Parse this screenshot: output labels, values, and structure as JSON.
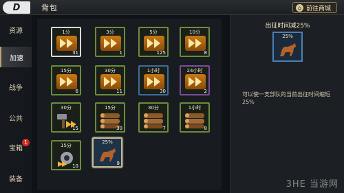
{
  "header": {
    "title": "背包",
    "shop_label": "前往商城"
  },
  "sidebar": {
    "items": [
      {
        "label": "资源"
      },
      {
        "label": "加速"
      },
      {
        "label": "战争"
      },
      {
        "label": "公共"
      },
      {
        "label": "宝箱",
        "badge": "1"
      },
      {
        "label": "装备"
      }
    ]
  },
  "grid": {
    "items": [
      {
        "label": "1分",
        "count": "31",
        "kind": "speedup"
      },
      {
        "label": "3分",
        "count": "1",
        "kind": "speedup"
      },
      {
        "label": "5分",
        "count": "125",
        "kind": "speedup"
      },
      {
        "label": "10分",
        "count": "8",
        "kind": "speedup"
      },
      {
        "label": "15分",
        "count": "6",
        "kind": "speedup"
      },
      {
        "label": "30分",
        "count": "11",
        "kind": "speedup"
      },
      {
        "label": "1小时",
        "count": "30",
        "kind": "speedup"
      },
      {
        "label": "24小时",
        "count": "2",
        "kind": "speedup"
      },
      {
        "label": "30分",
        "count": "15",
        "kind": "tool-speedup"
      },
      {
        "label": "15分",
        "count": "30",
        "kind": "logs"
      },
      {
        "label": "30分",
        "count": "7",
        "kind": "logs"
      },
      {
        "label": "1小时",
        "count": "8",
        "kind": "logs"
      },
      {
        "label": "15分",
        "count": "10",
        "kind": "gear-speedup"
      },
      {
        "label": "25%",
        "count": "9",
        "kind": "horse"
      }
    ]
  },
  "detail": {
    "title": "出征时间减25%",
    "item_label": "25%",
    "description": "可以使一支部队的当前出征时间缩短25%"
  },
  "watermark": "3HE 当游网"
}
